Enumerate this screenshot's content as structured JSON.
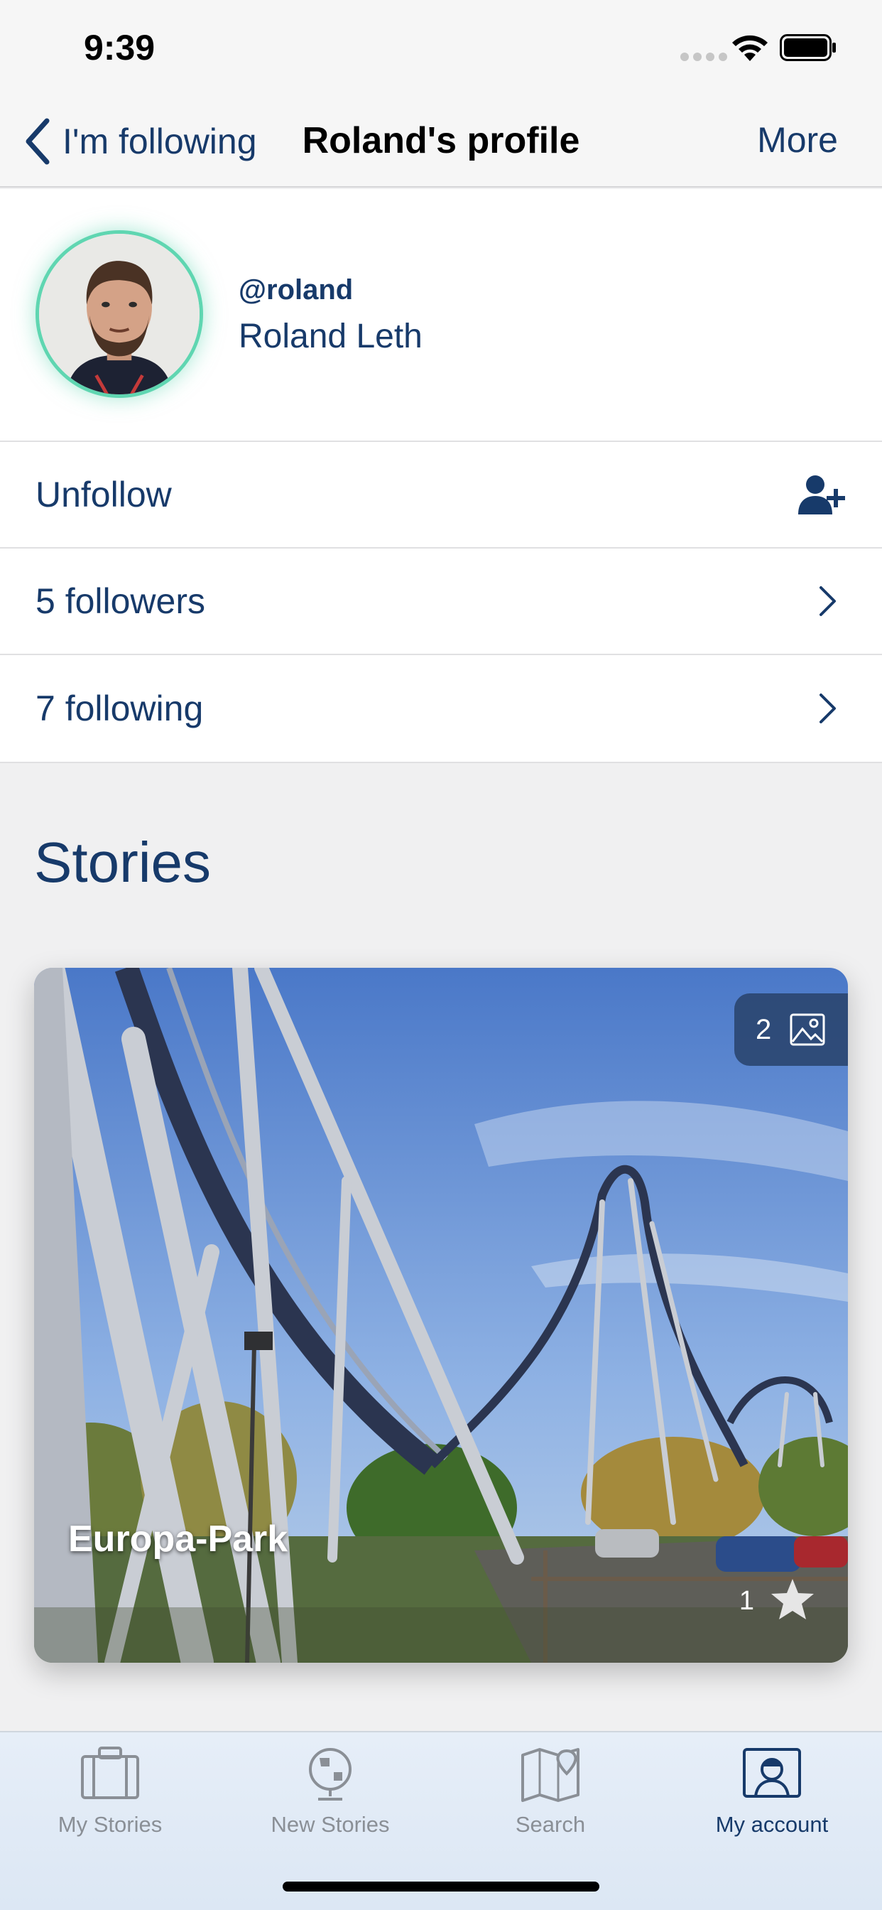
{
  "status_bar": {
    "time": "9:39"
  },
  "nav": {
    "back_label": "I'm following",
    "title": "Roland's profile",
    "more_label": "More"
  },
  "profile": {
    "username": "@roland",
    "full_name": "Roland Leth",
    "avatar_ring_color": "#5fd6b1"
  },
  "actions": {
    "unfollow_label": "Unfollow",
    "followers_label": "5 followers",
    "following_label": "7 following"
  },
  "stories": {
    "section_title": "Stories",
    "items": [
      {
        "title": "Europa-Park",
        "photo_count": "2",
        "star_count": "1"
      }
    ]
  },
  "tab_bar": {
    "tabs": [
      {
        "label": "My Stories",
        "icon": "suitcase-icon",
        "active": false
      },
      {
        "label": "New Stories",
        "icon": "globe-icon",
        "active": false
      },
      {
        "label": "Search",
        "icon": "map-icon",
        "active": false
      },
      {
        "label": "My account",
        "icon": "account-icon",
        "active": true
      }
    ]
  },
  "colors": {
    "brand": "#173a6a",
    "tab_inactive": "#8a8f96",
    "accent": "#5fd6b1"
  }
}
